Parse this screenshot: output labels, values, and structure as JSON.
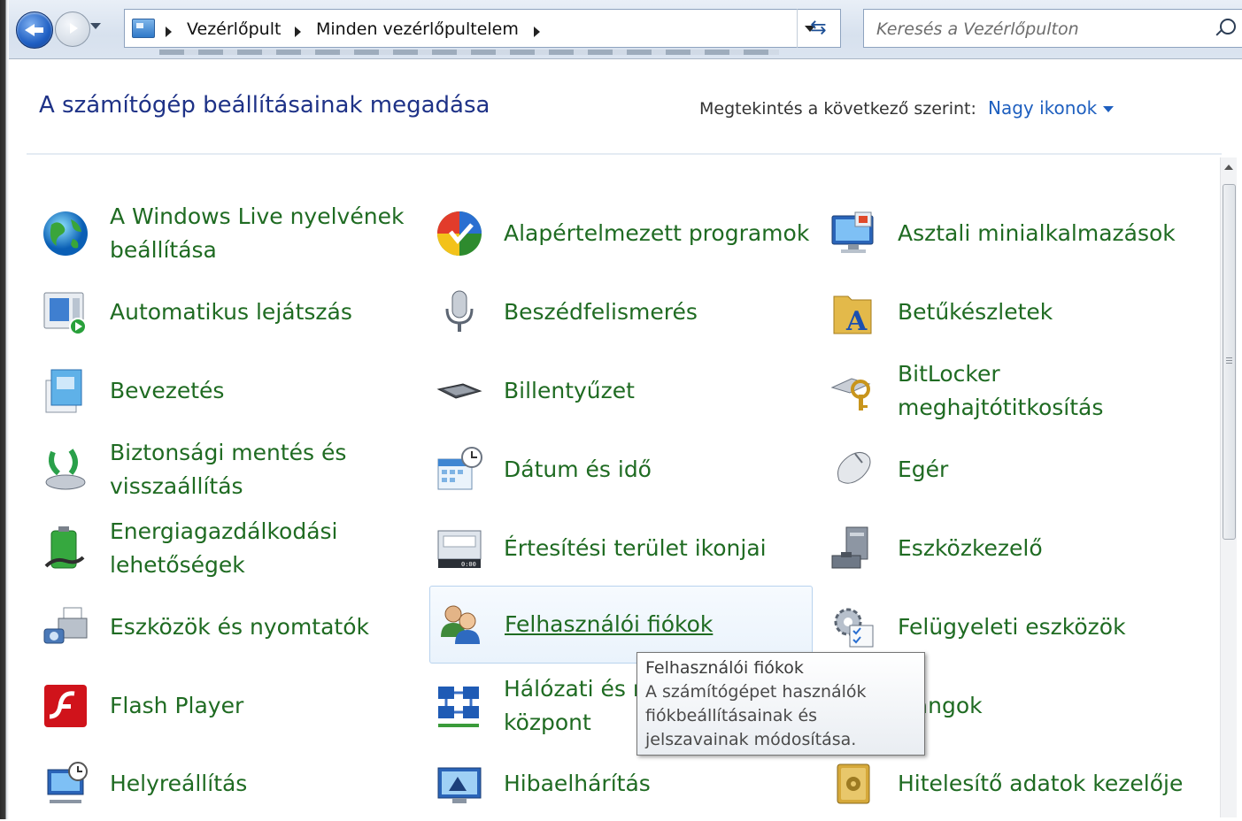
{
  "address_bar": {
    "breadcrumbs": [
      "Vezérlőpult",
      "Minden vezérlőpultelem"
    ],
    "search_placeholder": "Keresés a Vezérlőpulton"
  },
  "header": {
    "title": "A számítógép beállításainak megadása",
    "view_label": "Megtekintés a következő szerint:",
    "view_value": "Nagy ikonok"
  },
  "items": [
    {
      "label": "A Windows Live nyelvének beállítása",
      "icon": "globe-icon"
    },
    {
      "label": "Alapértelmezett programok",
      "icon": "default-programs-icon"
    },
    {
      "label": "Asztali minialkalmazások",
      "icon": "gadgets-icon"
    },
    {
      "label": "Automatikus lejátszás",
      "icon": "autoplay-icon"
    },
    {
      "label": "Beszédfelismerés",
      "icon": "microphone-icon"
    },
    {
      "label": "Betűkészletek",
      "icon": "fonts-folder-icon"
    },
    {
      "label": "Bevezetés",
      "icon": "getting-started-icon"
    },
    {
      "label": "Billentyűzet",
      "icon": "keyboard-icon"
    },
    {
      "label": "BitLocker meghajtótitkosítás",
      "icon": "bitlocker-icon"
    },
    {
      "label": "Biztonsági mentés és visszaállítás",
      "icon": "backup-icon"
    },
    {
      "label": "Dátum és idő",
      "icon": "date-time-icon"
    },
    {
      "label": "Egér",
      "icon": "mouse-icon"
    },
    {
      "label": "Energiagazdálkodási lehetőségek",
      "icon": "power-options-icon"
    },
    {
      "label": "Értesítési terület ikonjai",
      "icon": "notification-area-icon"
    },
    {
      "label": "Eszközkezelő",
      "icon": "device-manager-icon"
    },
    {
      "label": "Eszközök és nyomtatók",
      "icon": "devices-printers-icon"
    },
    {
      "label": "Felhasználói fiókok",
      "icon": "user-accounts-icon"
    },
    {
      "label": "Felügyeleti eszközök",
      "icon": "admin-tools-icon"
    },
    {
      "label": "Flash Player",
      "icon": "flash-player-icon"
    },
    {
      "label": "Hálózati és megosztási központ",
      "icon": "network-center-icon"
    },
    {
      "label": "Hangok",
      "icon": "sound-icon"
    },
    {
      "label": "Helyreállítás",
      "icon": "recovery-icon"
    },
    {
      "label": "Hibaelhárítás",
      "icon": "troubleshooting-icon"
    },
    {
      "label": "Hitelesítő adatok kezelője",
      "icon": "credential-manager-icon"
    }
  ],
  "tooltip": {
    "title": "Felhasználói fiókok",
    "description": "A számítógépet használók fiókbeállításainak és jelszavainak módosítása."
  }
}
